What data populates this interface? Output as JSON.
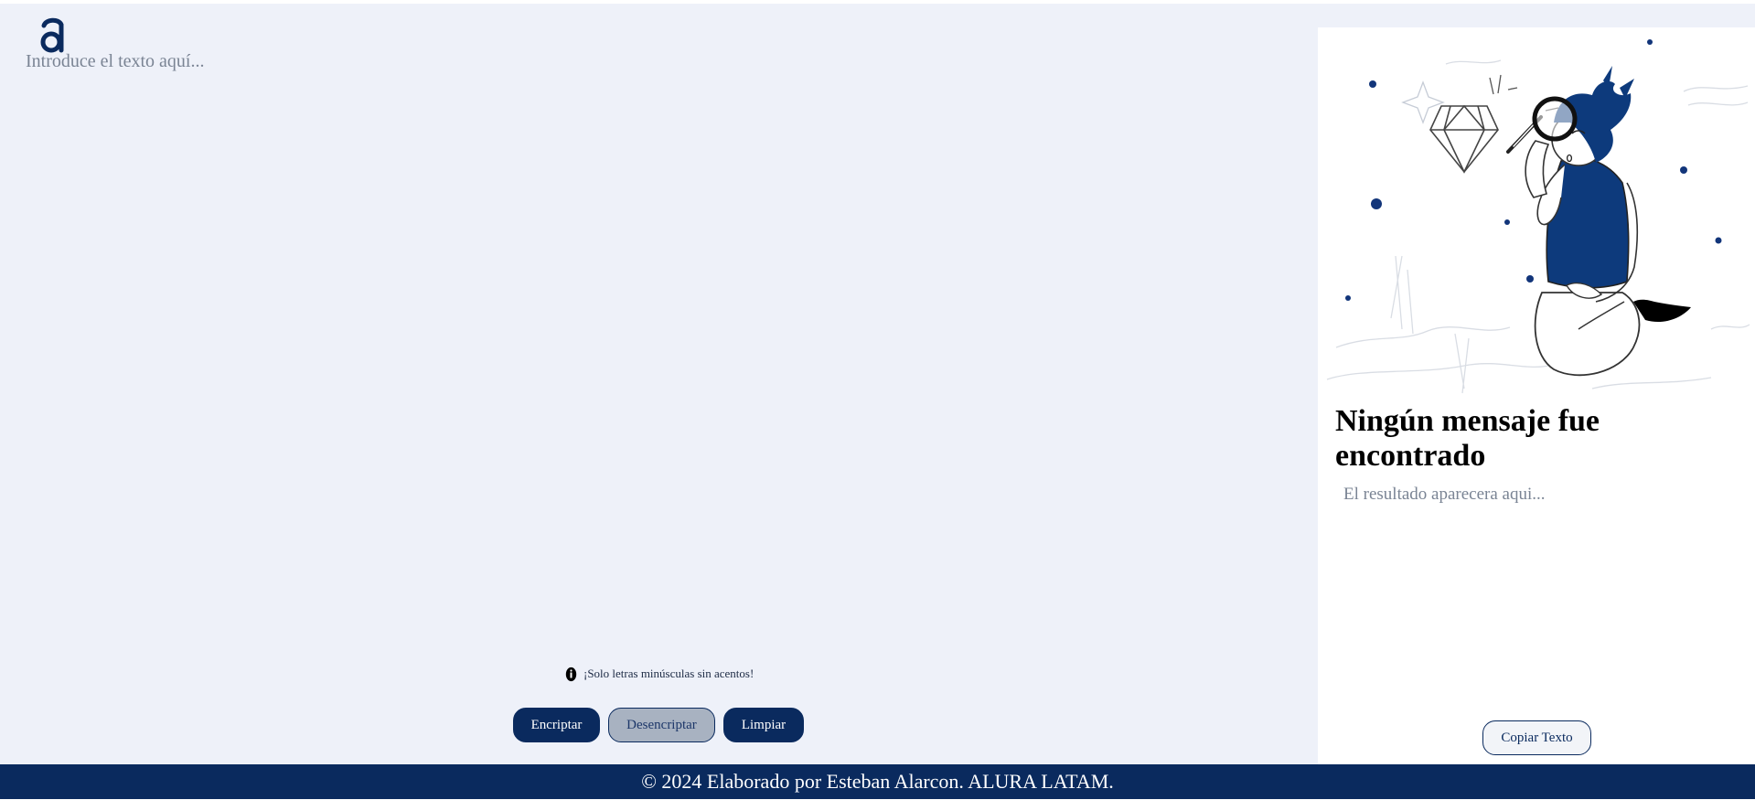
{
  "header": {
    "logo_icon": "alura-logo-icon"
  },
  "input": {
    "placeholder": "Introduce el texto aquí...",
    "value": ""
  },
  "hint": {
    "icon": "info-icon",
    "text": "¡Solo letras minúsculas sin acentos!"
  },
  "buttons": {
    "encrypt": "Encriptar",
    "decrypt": "Desencriptar",
    "clear": "Limpiar"
  },
  "output": {
    "illustration": "boy-with-magnifying-glass-illustration",
    "title": "Ningún mensaje fue encontrado",
    "placeholder": "El resultado aparecera aqui...",
    "copy_button": "Copiar Texto"
  },
  "footer": {
    "text": "© 2024 Elaborado por Esteban Alarcon. ALURA LATAM."
  },
  "colors": {
    "background": "#eef1f9",
    "primary": "#0a2a5e",
    "secondary_button": "#a8b2c1",
    "placeholder_text": "#7a8494",
    "accent_blue": "#1a3f86"
  }
}
